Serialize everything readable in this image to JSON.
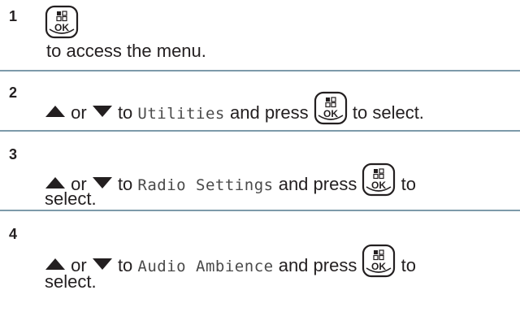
{
  "steps": [
    {
      "number": "1",
      "text": "to access the menu.",
      "icons": [
        "menu-ok-button-icon"
      ]
    },
    {
      "number": "2",
      "or": "or",
      "to": "to",
      "menu_item": "Utilities",
      "and_press": "and press",
      "to_select": "to select.",
      "icons": [
        "up-arrow-icon",
        "down-arrow-icon",
        "menu-ok-button-icon"
      ]
    },
    {
      "number": "3",
      "or": "or",
      "to": "to",
      "menu_item": "Radio Settings",
      "and_press": "and press",
      "to_word": "to",
      "select": "select.",
      "icons": [
        "up-arrow-icon",
        "down-arrow-icon",
        "menu-ok-button-icon"
      ]
    },
    {
      "number": "4",
      "or": "or",
      "to": "to",
      "menu_item": "Audio Ambience",
      "and_press": "and press",
      "to_word": "to",
      "select": "select.",
      "icons": [
        "up-arrow-icon",
        "down-arrow-icon",
        "menu-ok-button-icon"
      ]
    }
  ],
  "ok_button_label": "OK",
  "colors": {
    "text": "#231f20",
    "divider": "#7d9aaa"
  }
}
